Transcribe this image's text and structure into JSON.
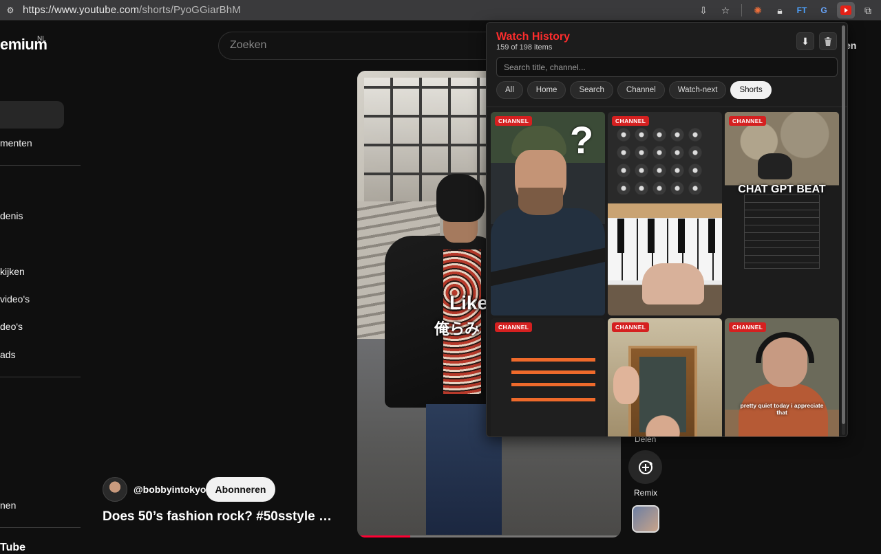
{
  "browser": {
    "url_host": "https://www.youtube.com",
    "url_path": "/shorts/PyoGGiarBhM"
  },
  "youtube": {
    "logo_text": "emium",
    "logo_region": "NL",
    "search_placeholder": "Zoeken",
    "header_right_text": "en",
    "sidebar": {
      "items": [
        "menten",
        "denis",
        "kijken",
        "video's",
        "deo's",
        "ads",
        "nen"
      ],
      "footer_heading": "Tube"
    },
    "video": {
      "caption_line1": "Like",
      "caption_line2": "俺らみ",
      "progress_fraction": 0.2
    },
    "channel_handle": "@bobbyintokyo",
    "subscribe_label": "Abonneren",
    "title": "Does 50’s fashion rock?  #50sstyle …",
    "actions": {
      "share_label": "Delen",
      "remix_label": "Remix"
    }
  },
  "extension": {
    "title": "Watch History",
    "count_text": "159 of 198 items",
    "search_placeholder": "Search title, channel...",
    "download_icon": "download-icon",
    "delete_icon": "trash-icon",
    "filters": [
      {
        "label": "All",
        "selected": false
      },
      {
        "label": "Home",
        "selected": false
      },
      {
        "label": "Search",
        "selected": false
      },
      {
        "label": "Channel",
        "selected": false
      },
      {
        "label": "Watch-next",
        "selected": false
      },
      {
        "label": "Shorts",
        "selected": true
      }
    ],
    "cards": [
      {
        "badge": "CHANNEL",
        "overlay": "?"
      },
      {
        "badge": "CHANNEL",
        "overlay": ""
      },
      {
        "badge": "CHANNEL",
        "overlay": "CHAT GPT BEAT"
      },
      {
        "badge": "CHANNEL",
        "overlay": ""
      },
      {
        "badge": "CHANNEL",
        "overlay": ""
      },
      {
        "badge": "CHANNEL",
        "overlay": "pretty quiet today i appreciate that"
      }
    ],
    "colors": {
      "accent": "#ff2d2d",
      "badge": "#d52020"
    }
  }
}
